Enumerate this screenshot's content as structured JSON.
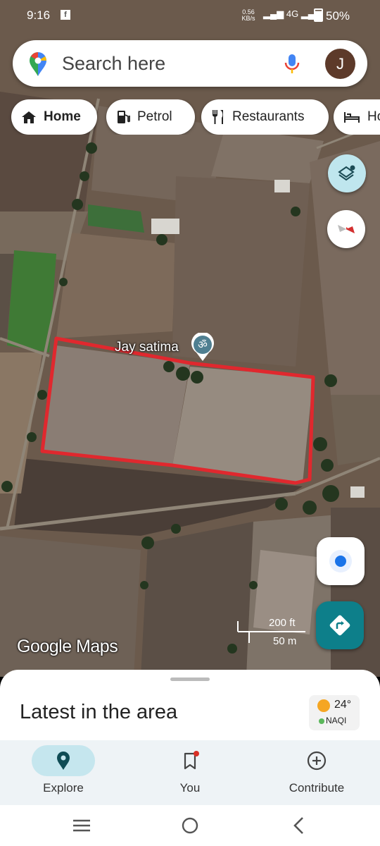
{
  "status_bar": {
    "time": "9:16",
    "app_icon": "facebook-icon",
    "speed_value": "0.56",
    "speed_unit": "KB/s",
    "network": "4G",
    "battery": "50%"
  },
  "search": {
    "placeholder": "Search here",
    "avatar_letter": "J"
  },
  "chips": [
    {
      "label": "Home",
      "icon": "home-icon"
    },
    {
      "label": "Petrol",
      "icon": "fuel-icon"
    },
    {
      "label": "Restaurants",
      "icon": "restaurant-icon"
    },
    {
      "label": "Ho",
      "icon": "hotel-icon"
    }
  ],
  "map": {
    "place_label": "Jay satima",
    "place_icon": "om-icon",
    "scale_ft": "200 ft",
    "scale_m": "50 m",
    "logo": "Google Maps",
    "boundary_color": "#e0282e"
  },
  "sheet": {
    "title": "Latest in the area",
    "temperature": "24°",
    "aqi": "NAQI"
  },
  "bottom_nav": [
    {
      "label": "Explore",
      "icon": "explore-pin-icon",
      "active": true
    },
    {
      "label": "You",
      "icon": "bookmark-icon",
      "active": false
    },
    {
      "label": "Contribute",
      "icon": "add-circle-icon",
      "active": false
    }
  ],
  "colors": {
    "accent": "#0d7f8a",
    "active_pill": "#c5e6ee",
    "nav_background": "#eef3f6"
  }
}
